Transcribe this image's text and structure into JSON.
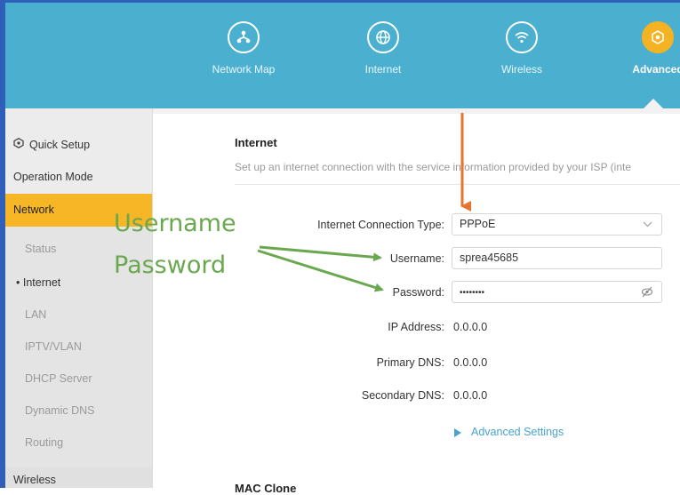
{
  "topnav": {
    "items": [
      {
        "label": "Network Map",
        "icon": "network-map-icon"
      },
      {
        "label": "Internet",
        "icon": "globe-icon"
      },
      {
        "label": "Wireless",
        "icon": "wifi-icon"
      },
      {
        "label": "Advanced",
        "icon": "gear-icon",
        "active": true
      }
    ]
  },
  "sidebar": {
    "items": [
      {
        "label": "Quick Setup",
        "icon": "quick-setup-icon"
      },
      {
        "label": "Operation Mode"
      },
      {
        "label": "Network",
        "active": true
      },
      {
        "label": "Status"
      },
      {
        "label": "Internet",
        "current": true,
        "bullet": "•"
      },
      {
        "label": "LAN"
      },
      {
        "label": "IPTV/VLAN"
      },
      {
        "label": "DHCP Server"
      },
      {
        "label": "Dynamic DNS"
      },
      {
        "label": "Routing"
      },
      {
        "label": "Wireless"
      }
    ]
  },
  "main": {
    "title": "Internet",
    "description": "Set up an internet connection with the service information provided by your ISP (inte",
    "form": {
      "connection_type_label": "Internet Connection Type:",
      "connection_type_value": "PPPoE",
      "username_label": "Username:",
      "username_value": "sprea45685",
      "password_label": "Password:",
      "password_value": "••••••••",
      "ip_label": "IP Address:",
      "ip_value": "0.0.0.0",
      "primary_dns_label": "Primary DNS:",
      "primary_dns_value": "0.0.0.0",
      "secondary_dns_label": "Secondary DNS:",
      "secondary_dns_value": "0.0.0.0"
    },
    "advanced_settings_label": "Advanced Settings",
    "mac_clone_title": "MAC Clone"
  },
  "annotations": {
    "username": "Username",
    "password": "Password",
    "green_color": "#6aa84f",
    "orange_color": "#e6762f"
  },
  "colors": {
    "header": "#4bb0d0",
    "accent": "#f6b626",
    "link": "#4aa3cf"
  }
}
